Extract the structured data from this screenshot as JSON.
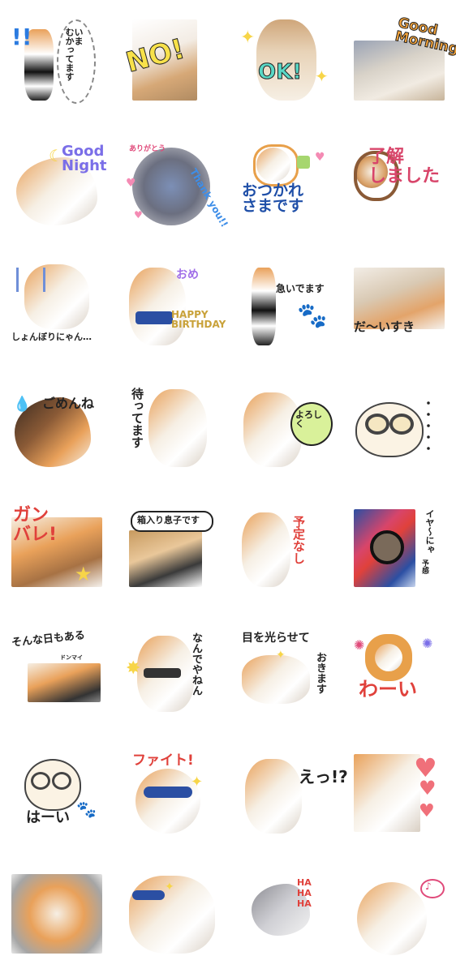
{
  "stickers": [
    {
      "id": 1,
      "text": "いま\nむかってます",
      "text2": "!!"
    },
    {
      "id": 2,
      "text": "NO!"
    },
    {
      "id": 3,
      "text": "OK!"
    },
    {
      "id": 4,
      "text": "Good\nMorning"
    },
    {
      "id": 5,
      "text": "Good\nNight"
    },
    {
      "id": 6,
      "text": "Thank you!!",
      "text2": "ありがとう"
    },
    {
      "id": 7,
      "text": "おつかれ\nさまです"
    },
    {
      "id": 8,
      "text": "了解\nしました"
    },
    {
      "id": 9,
      "text": "しょんぼりにゃん…"
    },
    {
      "id": 10,
      "text": "HAPPY\nBIRTHDAY",
      "text2": "おめ"
    },
    {
      "id": 11,
      "text": "急いでます"
    },
    {
      "id": 12,
      "text": "だ〜いすき"
    },
    {
      "id": 13,
      "text": "ごめんね"
    },
    {
      "id": 14,
      "text": "待ってます"
    },
    {
      "id": 15,
      "text": "よろしく"
    },
    {
      "id": 16,
      "text": "・・・・・"
    },
    {
      "id": 17,
      "text": "ガン\nバレ!"
    },
    {
      "id": 18,
      "text": "箱入り息子です"
    },
    {
      "id": 19,
      "text": "予定なし"
    },
    {
      "id": 20,
      "text": "イヤ〜にゃ",
      "text2": "予感"
    },
    {
      "id": 21,
      "text": "そんな日もある",
      "text2": "ドンマイ"
    },
    {
      "id": 22,
      "text": "なんでやねん"
    },
    {
      "id": 23,
      "text": "目を光らせて",
      "text2": "おきます"
    },
    {
      "id": 24,
      "text": "わーい"
    },
    {
      "id": 25,
      "text": "はーい"
    },
    {
      "id": 26,
      "text": "ファイト!"
    },
    {
      "id": 27,
      "text": "えっ!?"
    },
    {
      "id": 28,
      "text": ""
    },
    {
      "id": 29,
      "text": ""
    },
    {
      "id": 30,
      "text": ""
    },
    {
      "id": 31,
      "text": "HA HA HA"
    },
    {
      "id": 32,
      "text": ""
    }
  ]
}
